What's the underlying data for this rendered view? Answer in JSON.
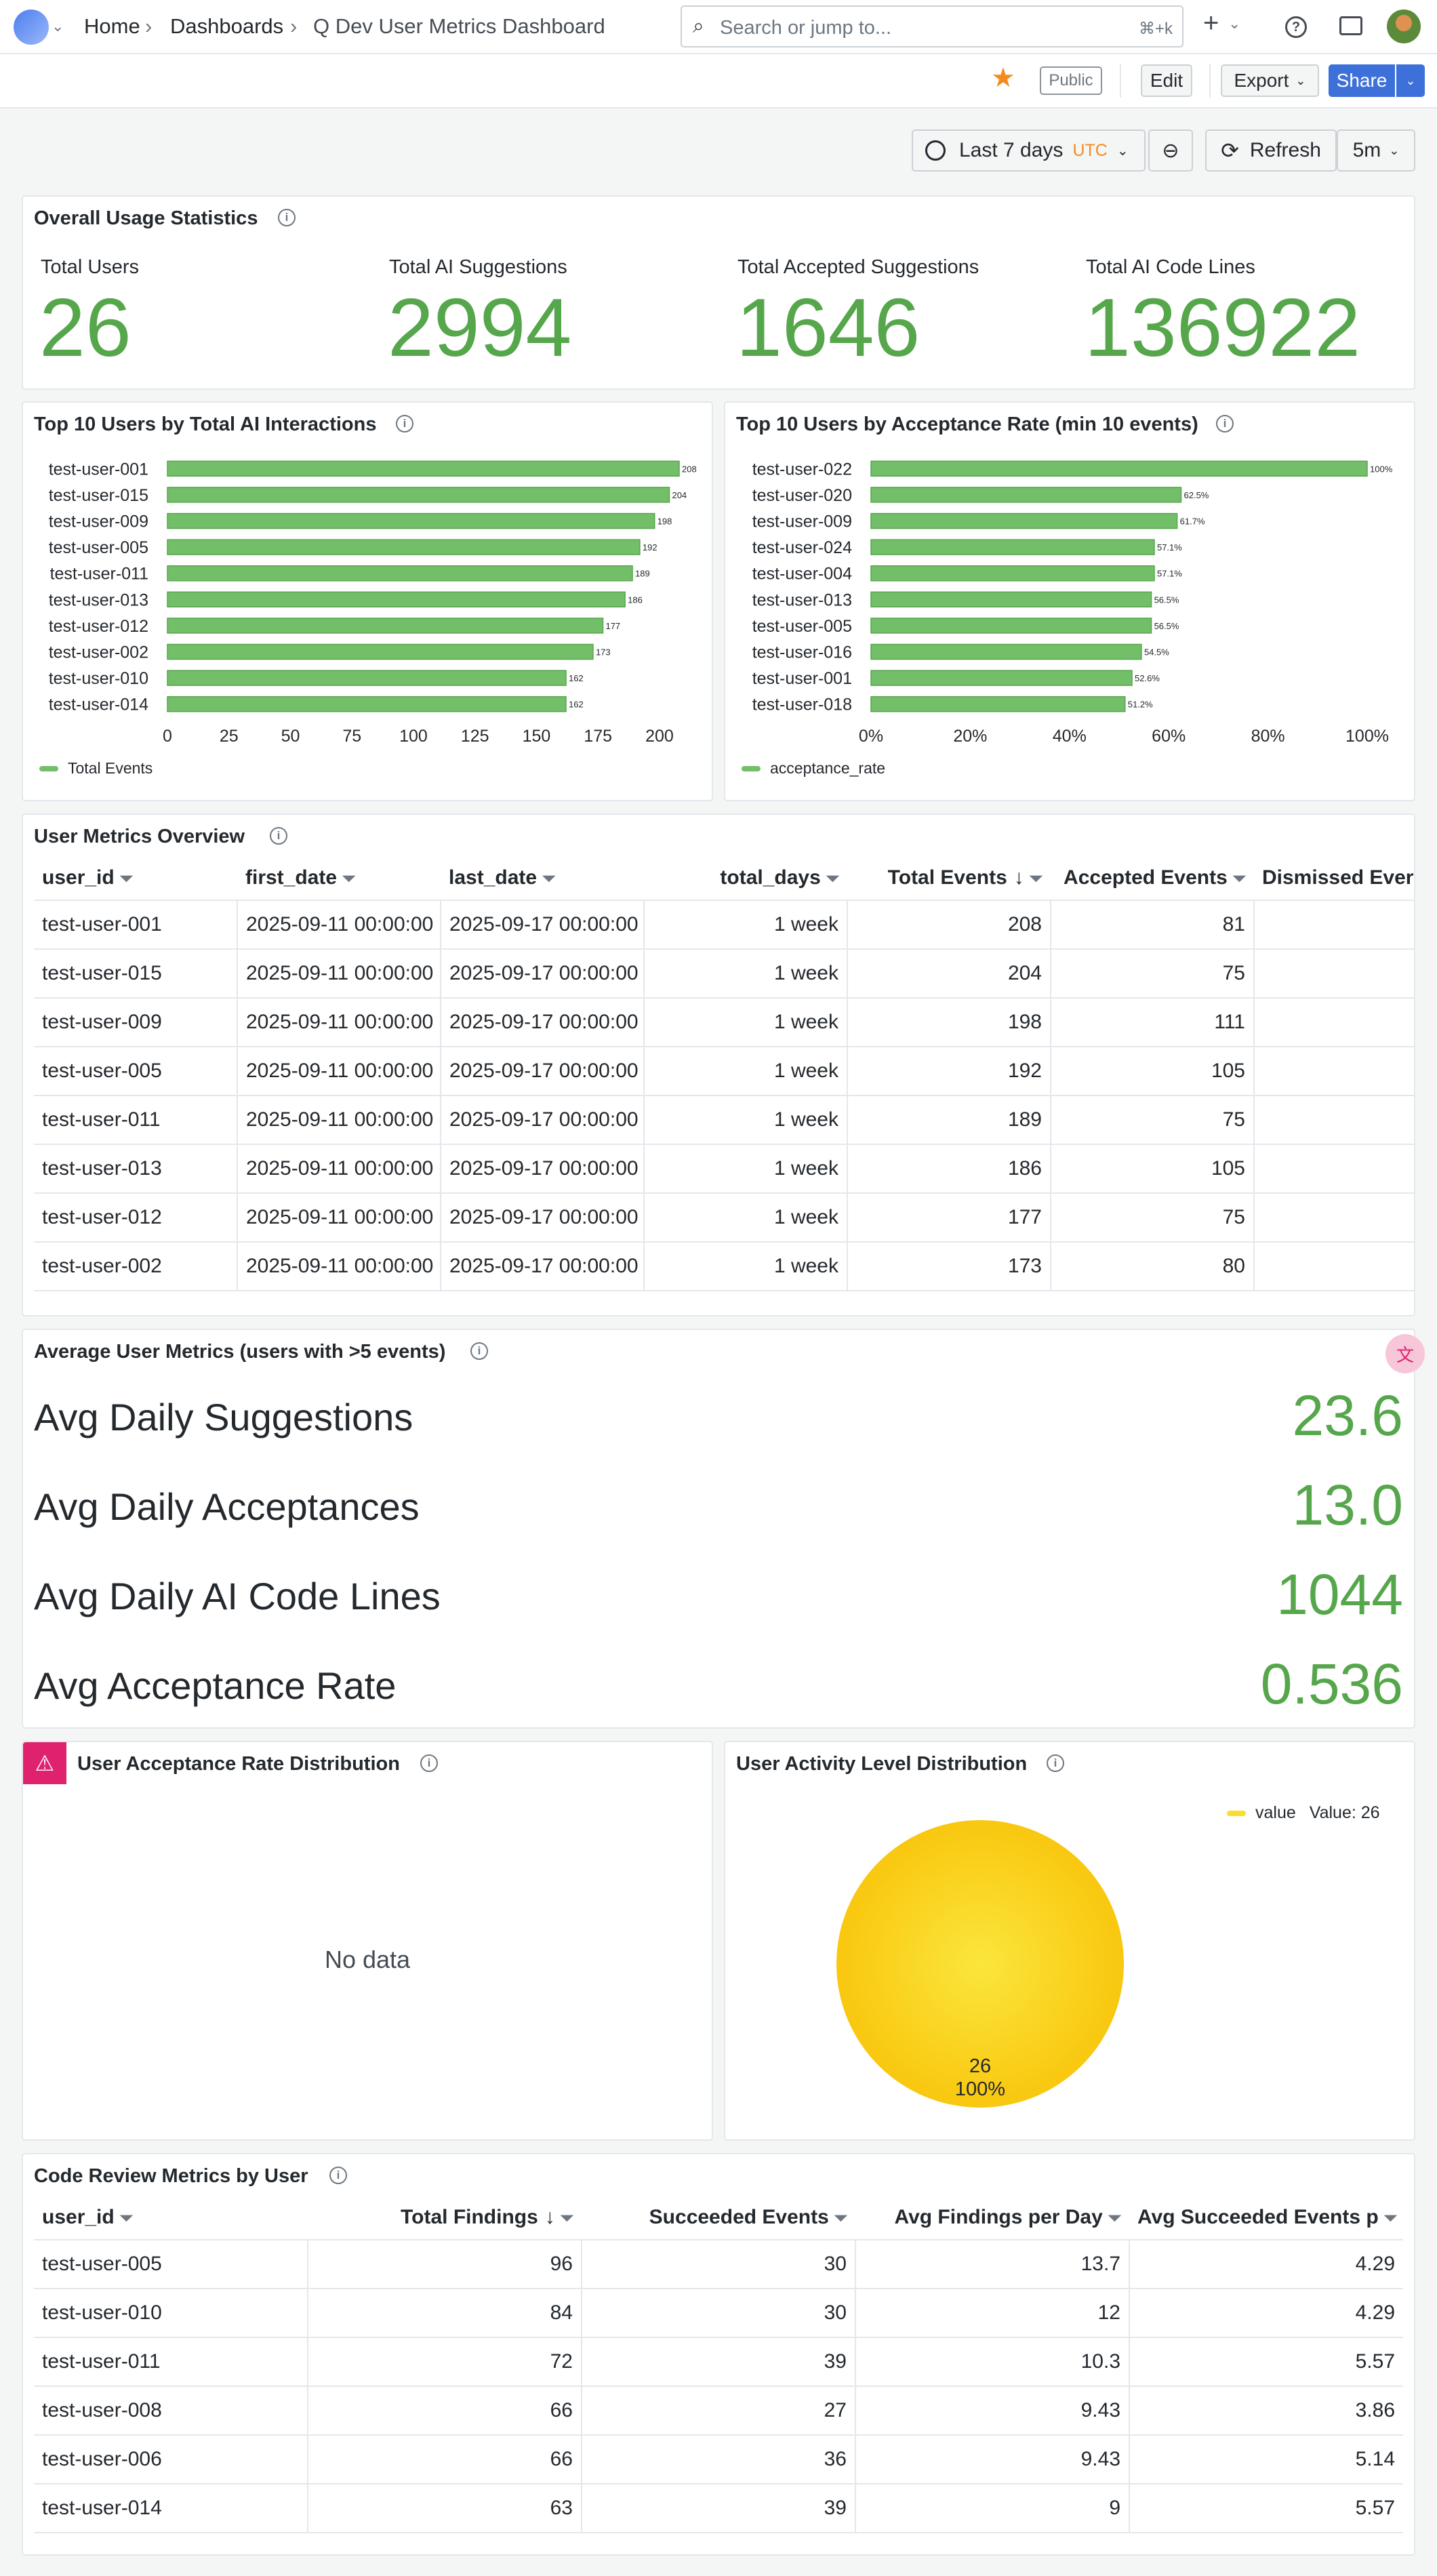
{
  "nav": {
    "breadcrumb_home": "Home",
    "breadcrumb_dashboards": "Dashboards",
    "breadcrumb_current": "Q Dev User Metrics Dashboard",
    "search_placeholder": "Search or jump to...",
    "search_shortcut": "⌘+k",
    "add_icon": "plus-icon",
    "help_icon": "help-icon",
    "tv_icon": "tv-icon"
  },
  "toolbar": {
    "public_badge": "Public",
    "edit_label": "Edit",
    "export_label": "Export",
    "share_label": "Share",
    "time_range": "Last 7 days",
    "timezone": "UTC",
    "refresh_label": "Refresh",
    "refresh_interval": "5m"
  },
  "overall": {
    "title": "Overall Usage Statistics",
    "stats": [
      {
        "label": "Total Users",
        "value": "26"
      },
      {
        "label": "Total AI Suggestions",
        "value": "2994"
      },
      {
        "label": "Total Accepted Suggestions",
        "value": "1646"
      },
      {
        "label": "Total AI Code Lines",
        "value": "136922"
      }
    ]
  },
  "chart_data": [
    {
      "type": "bar",
      "orientation": "horizontal",
      "title": "Top 10 Users by Total AI Interactions",
      "categories": [
        "test-user-001",
        "test-user-015",
        "test-user-009",
        "test-user-005",
        "test-user-011",
        "test-user-013",
        "test-user-012",
        "test-user-002",
        "test-user-010",
        "test-user-014"
      ],
      "series": [
        {
          "name": "Total Events",
          "values": [
            208,
            204,
            198,
            192,
            189,
            186,
            177,
            173,
            162,
            162
          ]
        }
      ],
      "data_labels": [
        "208",
        "204",
        "198",
        "192",
        "189",
        "186",
        "177",
        "173",
        "162",
        "162"
      ],
      "xlim": [
        0,
        208
      ],
      "xticks": [
        "0",
        "25",
        "50",
        "75",
        "100",
        "125",
        "150",
        "175",
        "200"
      ],
      "xtick_values": [
        0,
        25,
        50,
        75,
        100,
        125,
        150,
        175,
        200
      ],
      "legend": "bottom-left",
      "color": "#73bf69"
    },
    {
      "type": "bar",
      "orientation": "horizontal",
      "title": "Top 10 Users by Acceptance Rate (min 10 events)",
      "categories": [
        "test-user-022",
        "test-user-020",
        "test-user-009",
        "test-user-024",
        "test-user-004",
        "test-user-013",
        "test-user-005",
        "test-user-016",
        "test-user-001",
        "test-user-018"
      ],
      "series": [
        {
          "name": "acceptance_rate",
          "values": [
            1.0,
            0.625,
            0.617,
            0.571,
            0.571,
            0.565,
            0.565,
            0.545,
            0.526,
            0.512
          ]
        }
      ],
      "data_labels": [
        "100%",
        "62.5%",
        "61.7%",
        "57.1%",
        "57.1%",
        "56.5%",
        "56.5%",
        "54.5%",
        "52.6%",
        "51.2%"
      ],
      "xlim": [
        0,
        1
      ],
      "xticks": [
        "0%",
        "20%",
        "40%",
        "60%",
        "80%",
        "100%"
      ],
      "xtick_values": [
        0,
        0.2,
        0.4,
        0.6,
        0.8,
        1.0
      ],
      "legend": "bottom-left",
      "color": "#73bf69"
    },
    {
      "type": "pie",
      "title": "User Activity Level Distribution",
      "categories": [
        "value"
      ],
      "values": [
        26
      ],
      "slice_label": "26",
      "slice_percent": "100%",
      "legend_label": "value",
      "legend_value": "Value: 26",
      "legend": "top-right",
      "color": "#fade2a"
    }
  ],
  "user_metrics": {
    "title": "User Metrics Overview",
    "columns": [
      "user_id",
      "first_date",
      "last_date",
      "total_days",
      "Total Events",
      "Accepted Events",
      "Dismissed Ever"
    ],
    "rows": [
      [
        "test-user-001",
        "2025-09-11 00:00:00",
        "2025-09-17 00:00:00",
        "1 week",
        "208",
        "81"
      ],
      [
        "test-user-015",
        "2025-09-11 00:00:00",
        "2025-09-17 00:00:00",
        "1 week",
        "204",
        "75"
      ],
      [
        "test-user-009",
        "2025-09-11 00:00:00",
        "2025-09-17 00:00:00",
        "1 week",
        "198",
        "111"
      ],
      [
        "test-user-005",
        "2025-09-11 00:00:00",
        "2025-09-17 00:00:00",
        "1 week",
        "192",
        "105"
      ],
      [
        "test-user-011",
        "2025-09-11 00:00:00",
        "2025-09-17 00:00:00",
        "1 week",
        "189",
        "75"
      ],
      [
        "test-user-013",
        "2025-09-11 00:00:00",
        "2025-09-17 00:00:00",
        "1 week",
        "186",
        "105"
      ],
      [
        "test-user-012",
        "2025-09-11 00:00:00",
        "2025-09-17 00:00:00",
        "1 week",
        "177",
        "75"
      ],
      [
        "test-user-002",
        "2025-09-11 00:00:00",
        "2025-09-17 00:00:00",
        "1 week",
        "173",
        "80"
      ]
    ]
  },
  "avg_metrics": {
    "title": "Average User Metrics (users with >5 events)",
    "items": [
      {
        "label": "Avg Daily Suggestions",
        "value": "23.6"
      },
      {
        "label": "Avg Daily Acceptances",
        "value": "13.0"
      },
      {
        "label": "Avg Daily AI Code Lines",
        "value": "1044"
      },
      {
        "label": "Avg Acceptance Rate",
        "value": "0.536"
      }
    ]
  },
  "acceptance_dist": {
    "title": "User Acceptance Rate Distribution",
    "no_data": "No data"
  },
  "activity_dist": {
    "title": "User Activity Level Distribution",
    "legend_label": "value",
    "legend_value": "Value: 26",
    "slice_value": "26",
    "slice_percent": "100%"
  },
  "code_review": {
    "title": "Code Review Metrics by User",
    "columns": [
      "user_id",
      "Total Findings",
      "Succeeded Events",
      "Avg Findings per Day",
      "Avg Succeeded Events p"
    ],
    "rows": [
      [
        "test-user-005",
        "96",
        "30",
        "13.7",
        "4.29"
      ],
      [
        "test-user-010",
        "84",
        "30",
        "12",
        "4.29"
      ],
      [
        "test-user-011",
        "72",
        "39",
        "10.3",
        "5.57"
      ],
      [
        "test-user-008",
        "66",
        "27",
        "9.43",
        "3.86"
      ],
      [
        "test-user-006",
        "66",
        "36",
        "9.43",
        "5.14"
      ],
      [
        "test-user-014",
        "63",
        "39",
        "9",
        "5.57"
      ]
    ]
  },
  "colors": {
    "accent": "#56a64b",
    "bar": "#73bf69",
    "pie": "#fade2a",
    "share": "#3d71d9",
    "star": "#f58b1f",
    "alert": "#e0226e"
  }
}
